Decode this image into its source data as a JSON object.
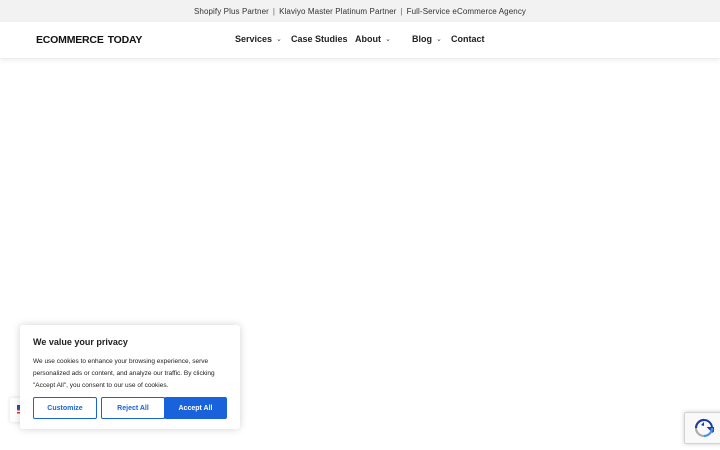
{
  "topbar": {
    "items": [
      "Shopify Plus Partner",
      "Klaviyo Master Platinum Partner",
      "Full-Service eCommerce Agency"
    ],
    "separator": "|"
  },
  "header": {
    "logo": {
      "word1": "ECOMMERCE",
      "word2": "TODAY"
    },
    "nav": [
      {
        "label": "Services",
        "has_dropdown": true
      },
      {
        "label": "Case Studies",
        "has_dropdown": false
      },
      {
        "label": "About",
        "has_dropdown": true
      },
      {
        "label": "Blog",
        "has_dropdown": true
      },
      {
        "label": "Contact",
        "has_dropdown": false
      }
    ],
    "chevron": "⌄"
  },
  "cookie_banner": {
    "title": "We value your privacy",
    "text": "We use cookies to enhance your browsing experience, serve personalized ads or content, and analyze our traffic. By clicking \"Accept All\", you consent to our use of cookies.",
    "buttons": {
      "customize": "Customize",
      "reject": "Reject All",
      "accept": "Accept All"
    },
    "accent_color": "#1863dc"
  },
  "icons": {
    "recaptcha": "recaptcha-icon",
    "flag": "us-flag-icon"
  }
}
